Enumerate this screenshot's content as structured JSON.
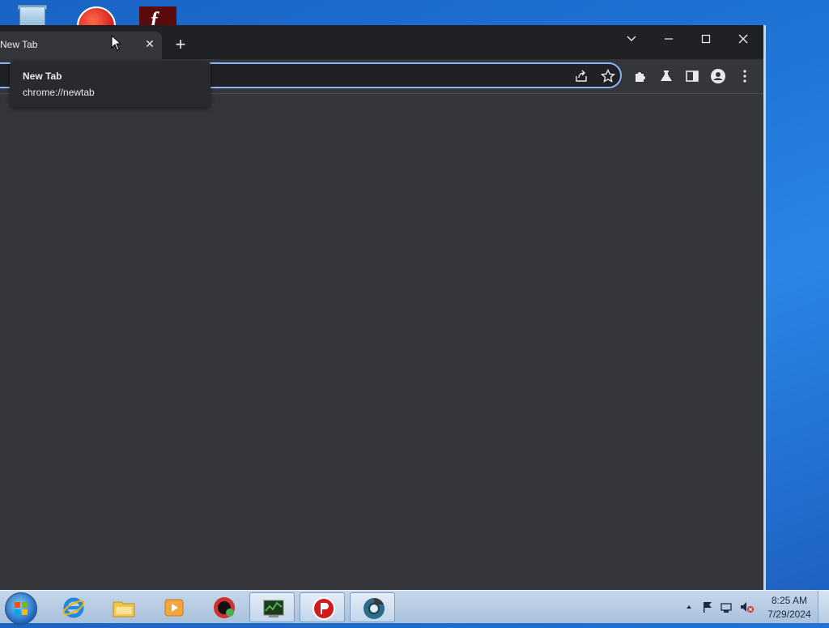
{
  "desktop": {
    "icons": [
      "recycle-bin",
      "pdf-app",
      "flash-app"
    ],
    "flash_glyph": "f"
  },
  "browser": {
    "tab": {
      "title": "New Tab",
      "close_glyph": "✕"
    },
    "new_tab_glyph": "+",
    "window_controls": {
      "tab_search": "⌄",
      "minimize": "—",
      "maximize": "☐",
      "close": "✕"
    },
    "tooltip": {
      "title": "New Tab",
      "url": "chrome://newtab"
    },
    "accent_color": "#8ab4f8",
    "background_color": "#35363a"
  },
  "taskbar": {
    "apps": [
      "internet-explorer",
      "file-explorer",
      "media-player",
      "chrome-red",
      "task-manager",
      "pdf-app",
      "chrome-active"
    ],
    "clock": {
      "time": "8:25 AM",
      "date": "7/29/2024"
    }
  }
}
